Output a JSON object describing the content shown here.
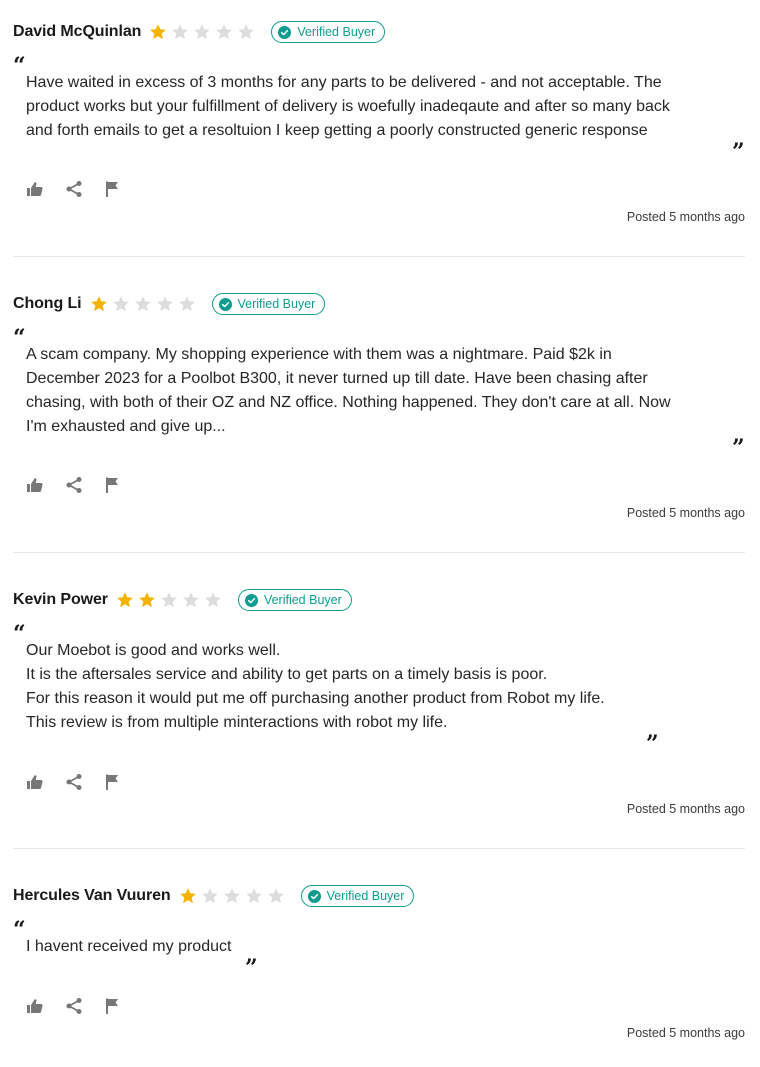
{
  "colors": {
    "star_filled": "#f5b300",
    "star_empty": "#dddddd",
    "badge": "#0e9c8e",
    "icon": "#777777"
  },
  "icons": {
    "rating": "star-icon",
    "badge": "check-circle-icon",
    "helpful": "thumbs-up-icon",
    "share": "share-icon",
    "report": "flag-icon"
  },
  "reviews": [
    {
      "name": "David McQuinlan",
      "rating": 1,
      "badge": "Verified Buyer",
      "body": [
        "Have waited in excess of 3 months for any parts to be delivered - and not acceptable. The",
        "product works but your fulfillment of delivery is woefully inadeqaute and after so many back",
        "and forth emails to get a resoltuion I keep getting a poorly constructed generic response"
      ],
      "posted": "Posted 5 months ago"
    },
    {
      "name": "Chong Li",
      "rating": 1,
      "badge": "Verified Buyer",
      "body": [
        "A scam company. My shopping experience with them was a nightmare. Paid $2k in",
        "December 2023 for a Poolbot B300, it never turned up till date. Have been chasing after",
        "chasing, with both of their OZ and NZ office. Nothing happened. They don't care at all. Now",
        "I'm exhausted and give up..."
      ],
      "posted": "Posted 5 months ago"
    },
    {
      "name": "Kevin Power",
      "rating": 2,
      "badge": "Verified Buyer",
      "body": [
        "Our Moebot is good and works well.",
        "It is the aftersales service and ability to get parts on a timely basis is poor.",
        "For this reason it would put me off purchasing another product from Robot my life.",
        "This review is from multiple minteractions with robot my life."
      ],
      "posted": "Posted 5 months ago"
    },
    {
      "name": "Hercules Van Vuuren",
      "rating": 1,
      "badge": "Verified Buyer",
      "body": [
        "I havent received my product"
      ],
      "posted": "Posted 5 months ago"
    }
  ]
}
